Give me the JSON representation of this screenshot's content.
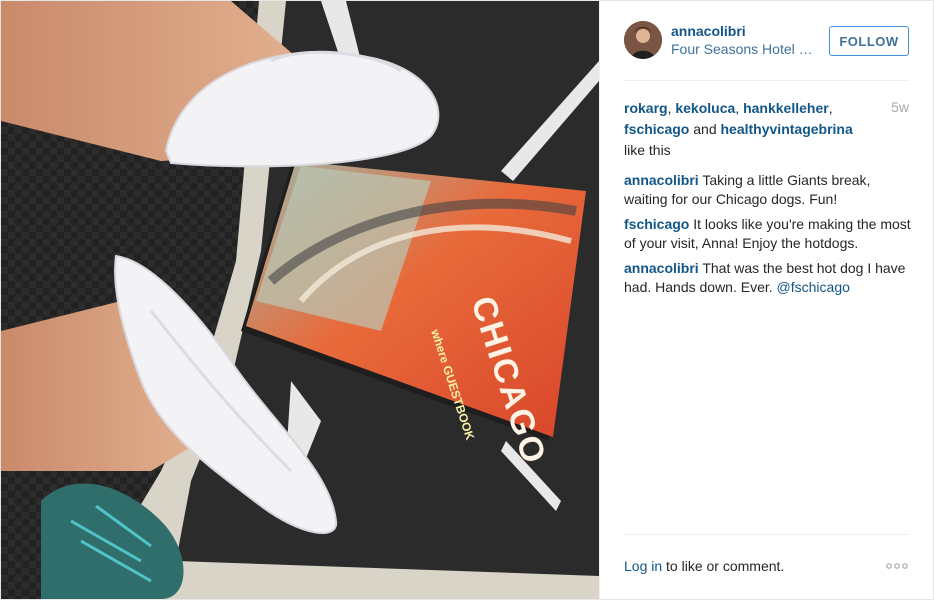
{
  "post": {
    "author": "annacolibri",
    "location": "Four Seasons Hotel Chicago",
    "follow_label": "FOLLOW",
    "time_ago": "5w",
    "likes": {
      "users": [
        "rokarg",
        "kekoluca",
        "hankkelleher",
        "fschicago",
        "healthyvintagebrina"
      ],
      "sep1": ", ",
      "sep2": ", ",
      "sep3": ", ",
      "and_word": " and ",
      "suffix": " like this"
    },
    "comments": [
      {
        "user": "annacolibri",
        "text": " Taking a little Giants break, waiting for our Chicago dogs. Fun!",
        "mention": ""
      },
      {
        "user": "fschicago",
        "text": " It looks like you're making the most of your visit, Anna! Enjoy the hotdogs.",
        "mention": ""
      },
      {
        "user": "annacolibri",
        "text": " That was the best hot dog I have had. Hands down. Ever. ",
        "mention": "@fschicago"
      }
    ],
    "footer": {
      "login_link": "Log in",
      "login_rest": " to like or comment."
    },
    "photo": {
      "magazine_title": "CHICAGO",
      "magazine_sub": "where GUESTBOOK"
    }
  },
  "colors": {
    "link": "#125688",
    "accent": "#3f729b",
    "follow_border": "#4090db",
    "muted": "#a5a7aa"
  }
}
